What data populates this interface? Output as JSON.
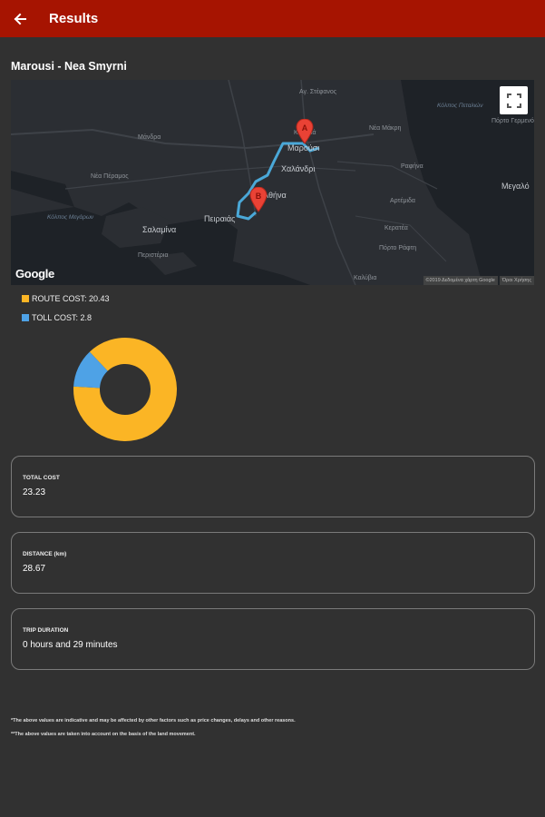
{
  "appbar": {
    "title": "Results",
    "back_icon": "arrow-left-icon"
  },
  "route": {
    "title": "Marousi - Nea Smyrni"
  },
  "map": {
    "labels": [
      {
        "text": "Αγ. Στέφανος",
        "kind": "town"
      },
      {
        "text": "Μάνδρα",
        "kind": "town"
      },
      {
        "text": "Νέα Μάκρη",
        "kind": "town"
      },
      {
        "text": "Χαλάνδρι",
        "kind": "city"
      },
      {
        "text": "Μαρούσι",
        "kind": "city"
      },
      {
        "text": "Κηφισιά",
        "kind": "town"
      },
      {
        "text": "Νέα Πέραμος",
        "kind": "town"
      },
      {
        "text": "Ραφήνα",
        "kind": "town"
      },
      {
        "text": "Αθήνα",
        "kind": "city"
      },
      {
        "text": "Πειραιάς",
        "kind": "city"
      },
      {
        "text": "Αρτέμιδα",
        "kind": "town"
      },
      {
        "text": "Σαλαμίνα",
        "kind": "town"
      },
      {
        "text": "Κόλπος Μεγάρων",
        "kind": "sea"
      },
      {
        "text": "Κόλπος Πεταλιών",
        "kind": "sea"
      },
      {
        "text": "Περιστέρια",
        "kind": "town"
      },
      {
        "text": "Πόρτο Ράφτη",
        "kind": "town"
      },
      {
        "text": "Μεγαλό",
        "kind": "city"
      },
      {
        "text": "Πόρτο Γερμενό",
        "kind": "town"
      },
      {
        "text": "Καλύβια",
        "kind": "town"
      },
      {
        "text": "Κερατέα",
        "kind": "town"
      }
    ],
    "marker_a": "A",
    "marker_b": "B",
    "google_logo": "Google",
    "attribution": "©2019 Δεδομένα χάρτη Google",
    "terms": "Όροι Χρήσης",
    "fullscreen_icon": "fullscreen-icon"
  },
  "legend": {
    "route_label": "ROUTE COST: 20.43",
    "toll_label": "TOLL COST: 2.8",
    "route_color": "#fbb525",
    "toll_color": "#4ea2e6"
  },
  "chart_data": {
    "type": "pie",
    "donut": true,
    "labels": [
      "ROUTE COST",
      "TOLL COST"
    ],
    "values": [
      20.43,
      2.8
    ],
    "colors": [
      "#fbb525",
      "#4ea2e6"
    ]
  },
  "cards": {
    "total": {
      "label": "TOTAL COST",
      "value": "23.23"
    },
    "distance": {
      "label": "DISTANCE (km)",
      "value": "28.67"
    },
    "duration": {
      "label": "TRIP DURATION",
      "value": "0 hours and 29 minutes"
    }
  },
  "notes": {
    "note1": "*The above values are indicative and may be affected by other factors such as price changes, delays and other reasons.",
    "note2": "**The above values are taken into account on the basis of the land movement."
  }
}
